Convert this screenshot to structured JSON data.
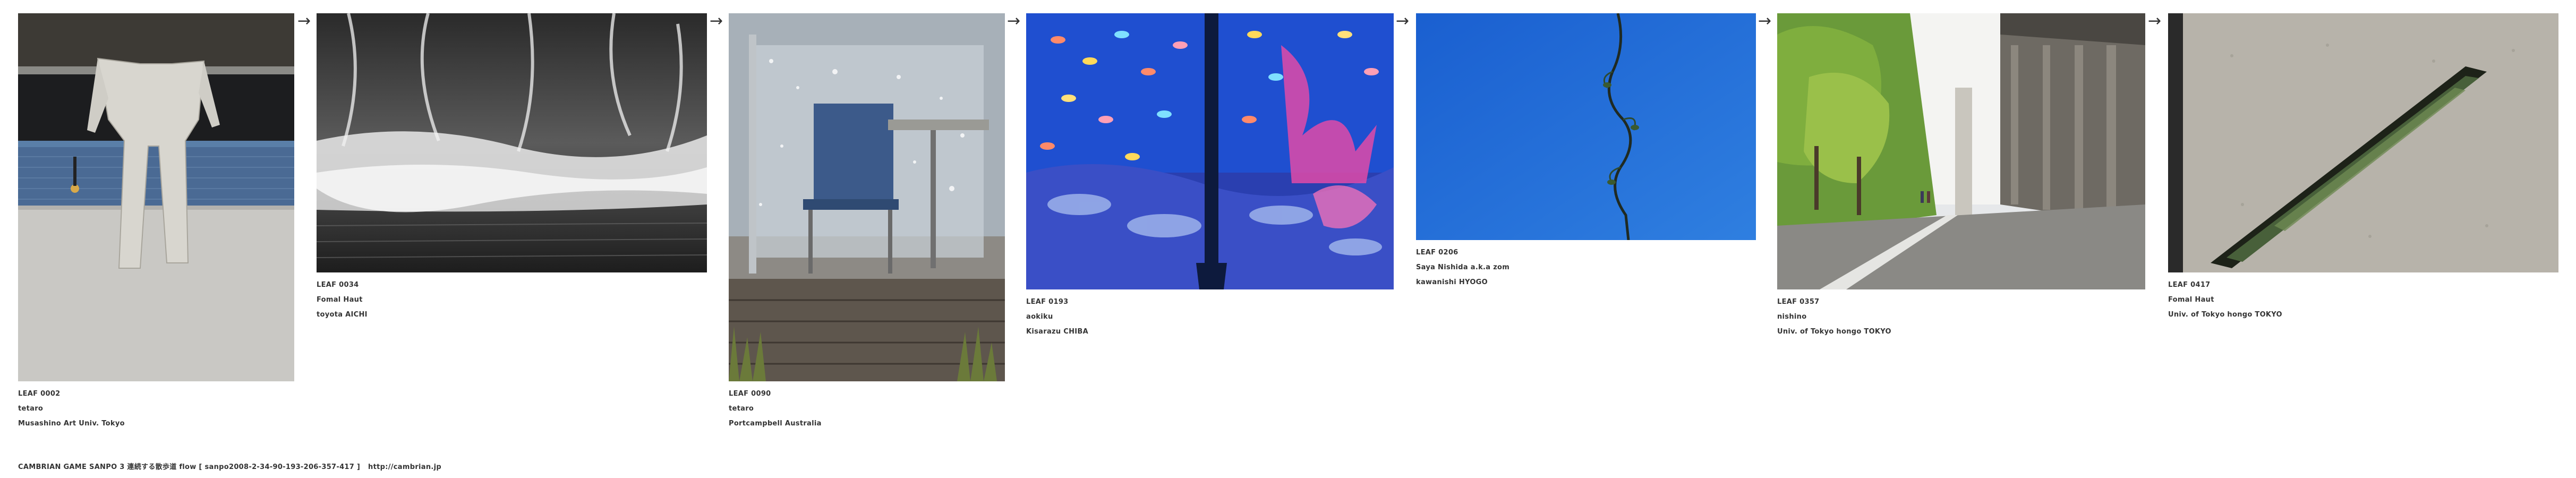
{
  "leaves": [
    {
      "id": "LEAF 0002",
      "name": "tetaro",
      "location": "Musashino Art Univ. Tokyo"
    },
    {
      "id": "LEAF 0034",
      "name": "Fomal Haut",
      "location": "toyota AICHI"
    },
    {
      "id": "LEAF 0090",
      "name": "tetaro",
      "location": "Portcampbell Australia"
    },
    {
      "id": "LEAF 0193",
      "name": "aokiku",
      "location": "Kisarazu  CHIBA"
    },
    {
      "id": "LEAF 0206",
      "name": "Saya Nishida a.k.a zom",
      "location": "kawanishi HYOGO"
    },
    {
      "id": "LEAF 0357",
      "name": "nishino",
      "location": "Univ. of Tokyo hongo TOKYO"
    },
    {
      "id": "LEAF 0417",
      "name": "Fomal Haut",
      "location": "Univ. of Tokyo hongo TOKYO"
    }
  ],
  "arrow": "→",
  "footer": {
    "text": "CAMBRIAN GAME  SANPO 3 連続する散歩道 flow [ sanpo2008-2-34-90-193-206-357-417 ]",
    "link": "http://cambrian.jp"
  }
}
